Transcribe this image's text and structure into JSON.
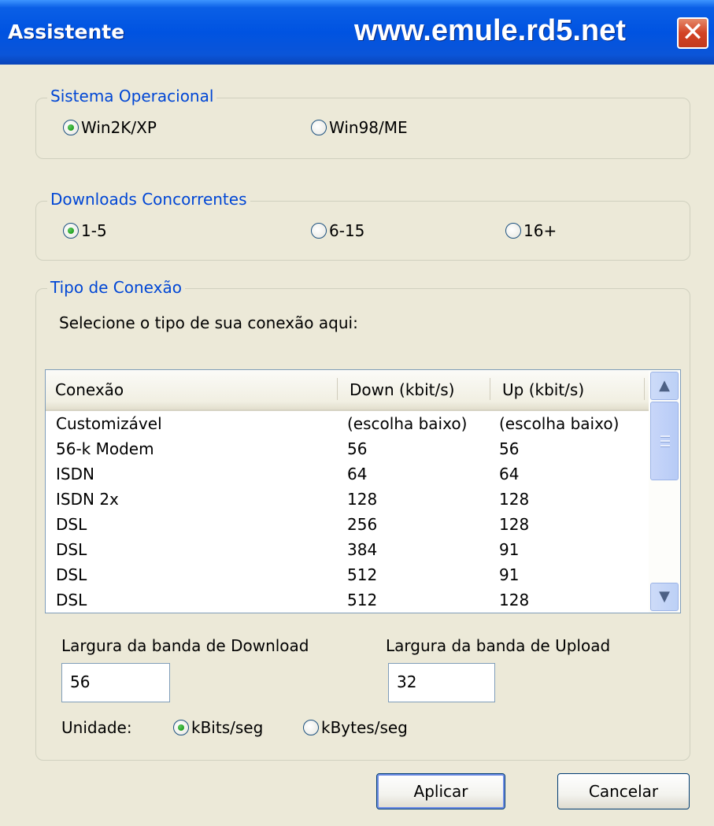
{
  "window": {
    "title": "Assistente",
    "banner_url": "www.emule.rd5.net",
    "close_glyph": "✕"
  },
  "os_group": {
    "legend": "Sistema Operacional",
    "options": [
      {
        "label": "Win2K/XP",
        "selected": true
      },
      {
        "label": "Win98/ME",
        "selected": false
      }
    ]
  },
  "downloads_group": {
    "legend": "Downloads Concorrentes",
    "options": [
      {
        "label": "1-5",
        "selected": true
      },
      {
        "label": "6-15",
        "selected": false
      },
      {
        "label": "16+",
        "selected": false
      }
    ]
  },
  "connection_group": {
    "legend": "Tipo de Conexão",
    "instruction": "Selecione o tipo de sua conexão aqui:",
    "table": {
      "columns": [
        "Conexão",
        "Down (kbit/s)",
        "Up (kbit/s)"
      ],
      "rows": [
        [
          "Customizável",
          "(escolha baixo)",
          "(escolha baixo)"
        ],
        [
          "56-k Modem",
          "56",
          "56"
        ],
        [
          "ISDN",
          "64",
          "64"
        ],
        [
          "ISDN 2x",
          "128",
          "128"
        ],
        [
          "DSL",
          "256",
          "128"
        ],
        [
          "DSL",
          "384",
          "91"
        ],
        [
          "DSL",
          "512",
          "91"
        ],
        [
          "DSL",
          "512",
          "128"
        ]
      ]
    },
    "download_label": "Largura da banda de Download",
    "download_value": "56",
    "upload_label": "Largura da banda de Upload",
    "upload_value": "32",
    "unit_label": "Unidade:",
    "units": [
      {
        "label": "kBits/seg",
        "selected": true
      },
      {
        "label": "kBytes/seg",
        "selected": false
      }
    ]
  },
  "buttons": {
    "apply": "Aplicar",
    "cancel": "Cancelar"
  },
  "icons": {
    "scroll_up": "up-arrow-icon",
    "scroll_down": "down-arrow-icon",
    "close": "close-icon"
  }
}
